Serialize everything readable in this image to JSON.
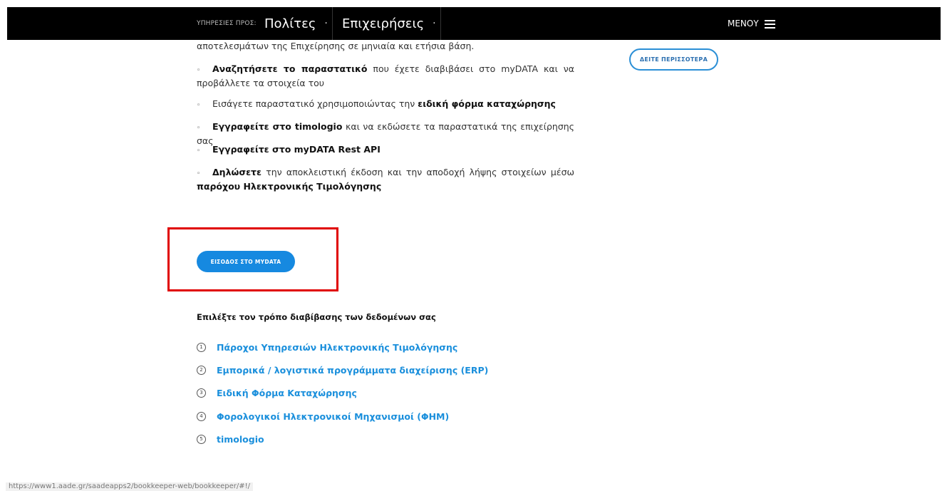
{
  "topbar": {
    "services_label": "ΥΠΗΡΕΣΙΕΣ ΠΡΟΣ:",
    "nav": [
      {
        "label": "Πολίτες",
        "dot": "·"
      },
      {
        "label": "Επιχειρήσεις",
        "dot": "·"
      }
    ],
    "menu_label": "ΜΕΝΟΥ"
  },
  "content": {
    "line0": "αποτελεσμάτων της Επιχείρησης σε μηνιαία και ετήσια βάση.",
    "items": [
      {
        "bold": "Αναζητήσετε το παραστατικό",
        "rest": " που έχετε διαβιβάσει στο myDATA και να προβάλλετε τα στοιχεία του"
      },
      {
        "pre": "Εισάγετε παραστατικό χρησιμοποιώντας την ",
        "bold": "ειδική φόρμα καταχώρησης"
      },
      {
        "bold": "Εγγραφείτε στο timologio",
        "rest": " και να εκδώσετε τα παραστατικά της επιχείρησης σας"
      },
      {
        "bold": "Εγγραφείτε στο myDATA Rest API"
      },
      {
        "bold": "Δηλώσετε",
        "rest": " την αποκλειστική έκδοση και την αποδοχή λήψης στοιχείων μέσω ",
        "bold2": "παρόχου Ηλεκτρονικής Τιμολόγησης"
      }
    ],
    "bullet": "◦"
  },
  "more_button": "ΔΕΙΤΕ ΠΕΡΙΣΣΟΤΕΡΑ",
  "login_button": "ΕΙΣΟΔΟΣ ΣΤΟ MYDATA",
  "choose_heading": "Επιλέξτε τον τρόπο διαβίβασης των δεδομένων σας",
  "options": [
    {
      "num": "1",
      "label": "Πάροχοι Υπηρεσιών Ηλεκτρονικής Τιμολόγησης"
    },
    {
      "num": "2",
      "label": "Εμπορικά / λογιστικά προγράμματα διαχείρισης (ERP)"
    },
    {
      "num": "3",
      "label": "Ειδική Φόρμα Καταχώρησης"
    },
    {
      "num": "4",
      "label": "Φορολογικοί Ηλεκτρονικοί Μηχανισμοί (ΦΗΜ)"
    },
    {
      "num": "5",
      "label": "timologio"
    }
  ],
  "status_url": "https://www1.aade.gr/saadeapps2/bookkeeper-web/bookkeeper/#!/"
}
